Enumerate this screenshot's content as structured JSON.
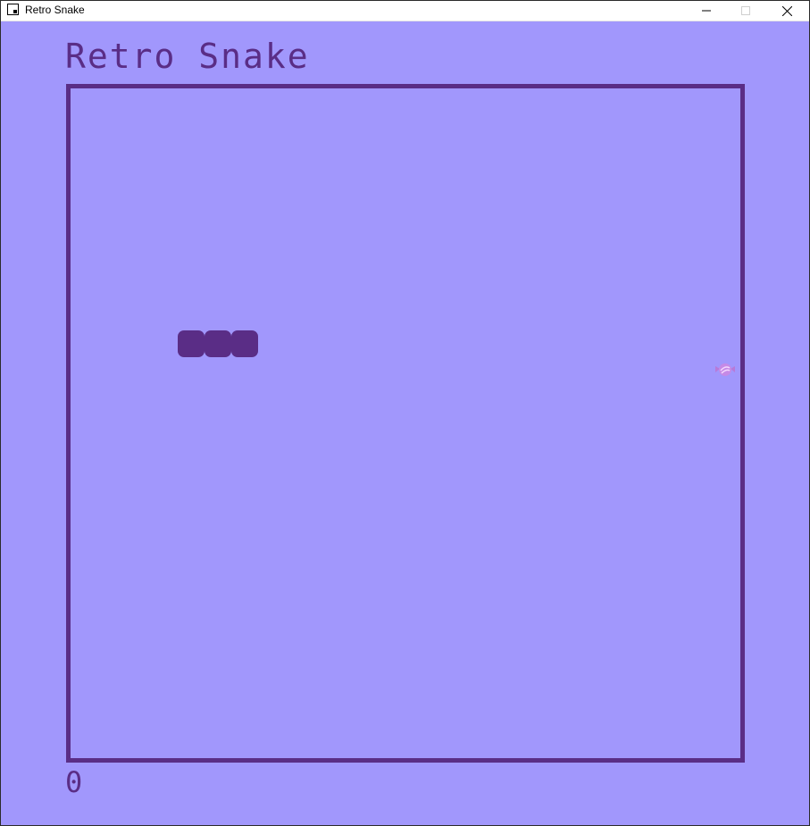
{
  "window": {
    "title": "Retro Snake",
    "icon": "app-window-icon",
    "controls": [
      "minimize-icon",
      "maximize-icon",
      "close-icon"
    ]
  },
  "game": {
    "title": "Retro Snake",
    "score": "0",
    "snake_length": 3,
    "colors": {
      "background": "#a197fc",
      "foreground": "#5a2d86",
      "food": "#c68ae6"
    },
    "food_icon": "candy-icon"
  }
}
